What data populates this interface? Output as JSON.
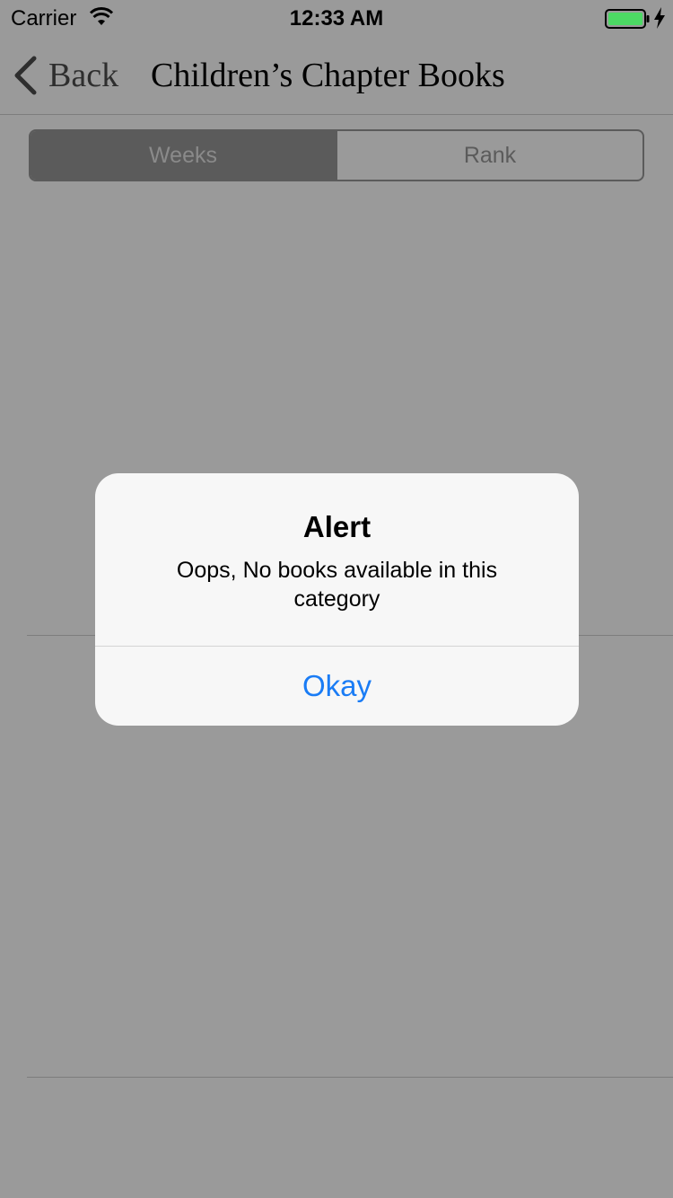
{
  "status_bar": {
    "carrier": "Carrier",
    "time": "12:33 AM",
    "battery_color": "#4cd964"
  },
  "nav": {
    "back_label": "Back",
    "title": "Children’s Chapter Books"
  },
  "segmented": {
    "segments": [
      {
        "label": "Weeks",
        "selected": true
      },
      {
        "label": "Rank",
        "selected": false
      }
    ]
  },
  "alert": {
    "title": "Alert",
    "message": "Oops, No books available in this category",
    "button_label": "Okay",
    "button_color": "#1a7cf5"
  }
}
